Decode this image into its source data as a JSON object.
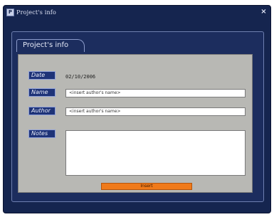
{
  "window": {
    "title": "Project's info",
    "close_glyph": "×",
    "icon_glyph": "P"
  },
  "tab": {
    "label": "Project's info"
  },
  "form": {
    "date_label": "Date",
    "date_value": "02/10/2006",
    "name_label": "Name",
    "name_value": "<insert author's name>",
    "author_label": "Author",
    "author_value": "<insert author's name>",
    "notes_label": "Notes",
    "notes_value": "",
    "insert_button": "Insert"
  },
  "colors": {
    "window_bg": "#15254f",
    "panel_bg": "#1c2d5e",
    "content_bg": "#b8b8b4",
    "label_bg": "#1e3378",
    "button_bg": "#f07a1a"
  }
}
